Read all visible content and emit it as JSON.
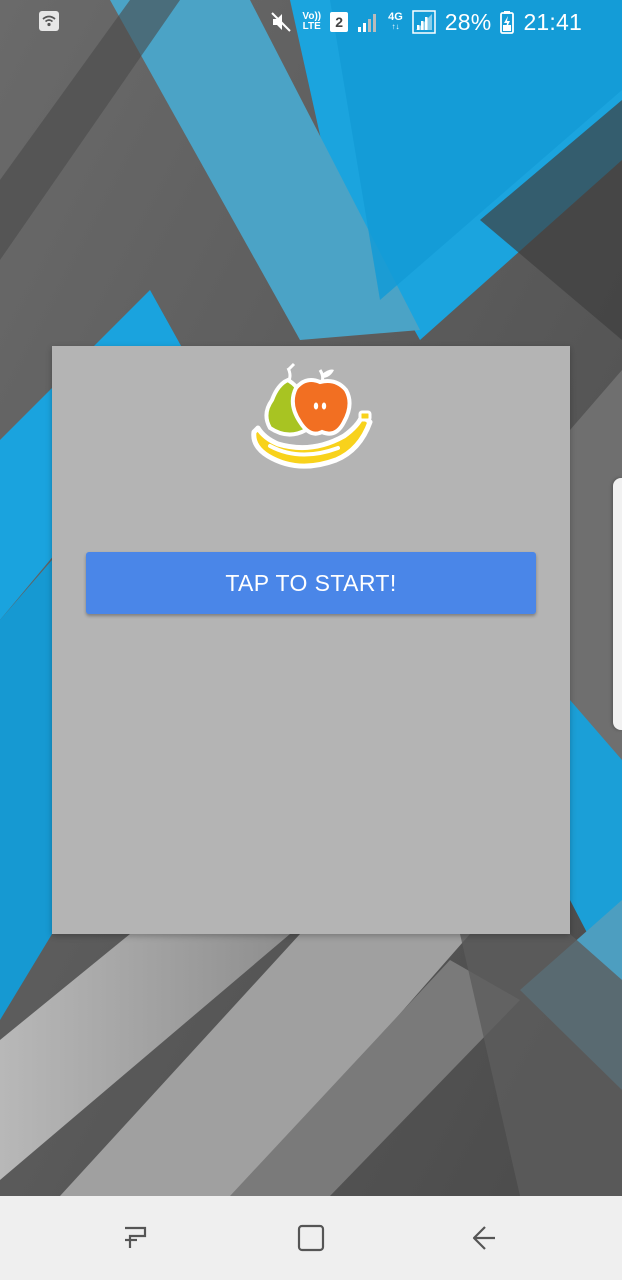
{
  "status_bar": {
    "battery_percent": "28%",
    "time": "21:41",
    "sim_slot": "2",
    "volte_label_top": "Vo))",
    "volte_label_bottom": "LTE",
    "network_type": "4G",
    "icons": [
      "wifi-call-icon",
      "mute-icon",
      "volte-icon",
      "sim-2-icon",
      "signal-icon",
      "4g-data-icon",
      "signal-icon",
      "battery-charging-icon"
    ]
  },
  "dialog": {
    "logo_icon": "fruit-bowl-logo-icon",
    "start_button_label": "TAP TO START!",
    "button_color": "#4a86e8",
    "background_color": "#b4b4b4"
  },
  "nav_bar": {
    "items": [
      "recent-apps-icon",
      "home-icon",
      "back-icon"
    ]
  },
  "colors": {
    "wallpaper_blue": "#17a2dc",
    "wallpaper_dark": "#555555",
    "wallpaper_light": "#a8a8a8"
  }
}
